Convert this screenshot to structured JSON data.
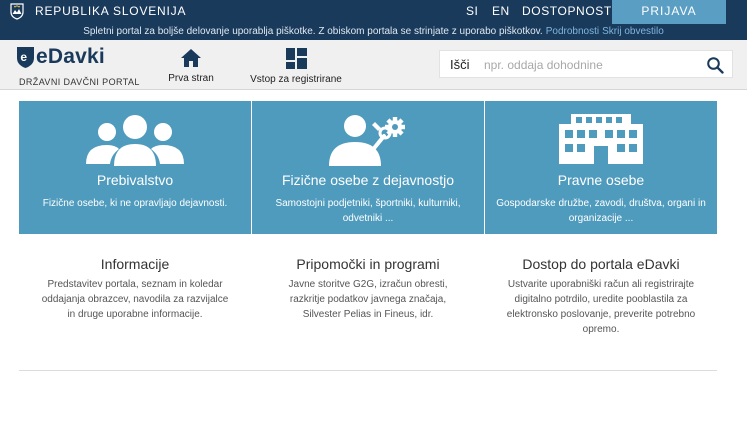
{
  "topbar": {
    "country": "REPUBLIKA SLOVENIJA",
    "crest_icon": "slovenia-crest-icon",
    "lang_si": "SI",
    "lang_en": "EN",
    "accessibility": "DOSTOPNOST",
    "login": "PRIJAVA",
    "colors": {
      "background": "#1a3a5c",
      "login": "#5a9ec4"
    }
  },
  "cookie": {
    "text": "Spletni portal za boljše delovanje uporablja piškotke. Z obiskom portala se strinjate z uporabo piškotkov.",
    "details_link": "Podrobnosti",
    "hide_link": "Skrij obvestilo"
  },
  "header": {
    "brand": "eDavki",
    "subtitle": "DRŽAVNI DAVČNI PORTAL",
    "nav": [
      {
        "label": "Prva stran",
        "icon": "home-icon"
      },
      {
        "label": "Vstop za registrirane",
        "icon": "dashboard-icon"
      }
    ],
    "search": {
      "label": "Išči",
      "placeholder": "npr. oddaja dohodnine",
      "icon": "search-icon"
    }
  },
  "tiles": [
    {
      "title": "Prebivalstvo",
      "desc": "Fizične osebe, ki ne opravljajo dejavnosti.",
      "icon": "people-group-icon"
    },
    {
      "title": "Fizične osebe z dejavnostjo",
      "desc": "Samostojni podjetniki, športniki, kulturniki, odvetniki ...",
      "icon": "person-tools-icon"
    },
    {
      "title": "Pravne osebe",
      "desc": "Gospodarske družbe, zavodi, društva, organi in organizacije ...",
      "icon": "building-icon"
    }
  ],
  "info": [
    {
      "title": "Informacije",
      "desc": "Predstavitev portala, seznam in koledar oddajanja obrazcev, navodila za razvijalce in druge uporabne informacije."
    },
    {
      "title": "Pripomočki in programi",
      "desc": "Javne storitve G2G, izračun obresti, razkritje podatkov javnega značaja, Silvester Pelias in Fineus, idr."
    },
    {
      "title": "Dostop do portala eDavki",
      "desc": "Ustvarite uporabniški račun ali registrirajte digitalno potrdilo, uredite pooblastila za elektronsko poslovanje, preverite potrebno opremo."
    }
  ],
  "colors": {
    "tile": "#4f9bbd",
    "brand": "#1a3a5c"
  }
}
